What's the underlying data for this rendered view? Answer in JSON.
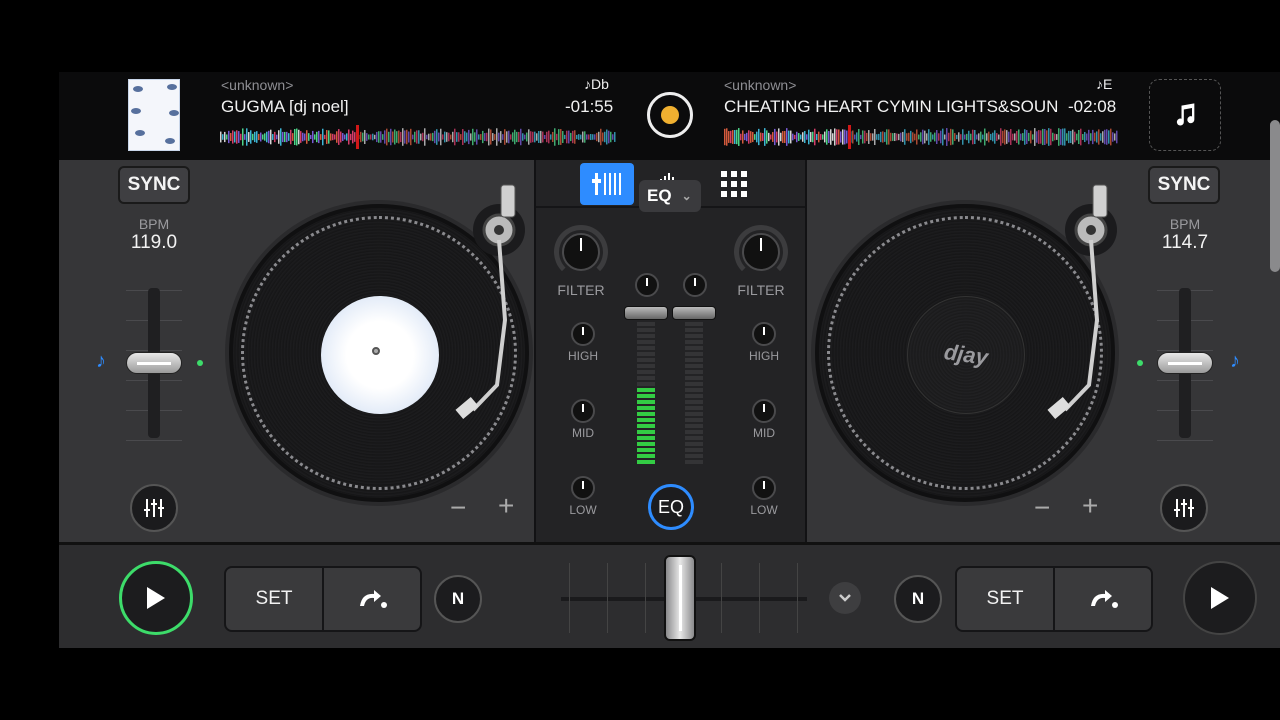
{
  "deck_left": {
    "artist": "<unknown>",
    "title": "GUGMA [dj noel]",
    "key": "Db",
    "time": "-01:55",
    "sync_label": "SYNC",
    "bpm_label": "BPM",
    "bpm_value": "119.0",
    "play_state": "playing"
  },
  "deck_right": {
    "artist": "<unknown>",
    "title": "CHEATING HEART CYMIN LIGHTS&SOUN",
    "key": "E",
    "time": "-02:08",
    "sync_label": "SYNC",
    "bpm_label": "BPM",
    "bpm_value": "114.7",
    "platter_logo": "djay",
    "play_state": "paused"
  },
  "mixer": {
    "tabs": [
      {
        "icon": "mixer-faders-icon",
        "active": true
      },
      {
        "icon": "waveform-icon",
        "active": false
      },
      {
        "icon": "pads-grid-icon",
        "active": false
      }
    ],
    "mode": "EQ",
    "filter_label": "FILTER",
    "high_label": "HIGH",
    "mid_label": "MID",
    "low_label": "LOW",
    "eq_button": "EQ",
    "meter_left_level": 0.58,
    "meter_right_level": 0.0
  },
  "transport": {
    "set_label": "SET",
    "minus": "−",
    "plus": "+",
    "n_label": "N"
  },
  "crossfader_position": 0.47,
  "colors": {
    "accent_blue": "#2e8cff",
    "play_green": "#3ddc6a",
    "meter_green": "#33cc44",
    "needle_red": "#d01818"
  }
}
